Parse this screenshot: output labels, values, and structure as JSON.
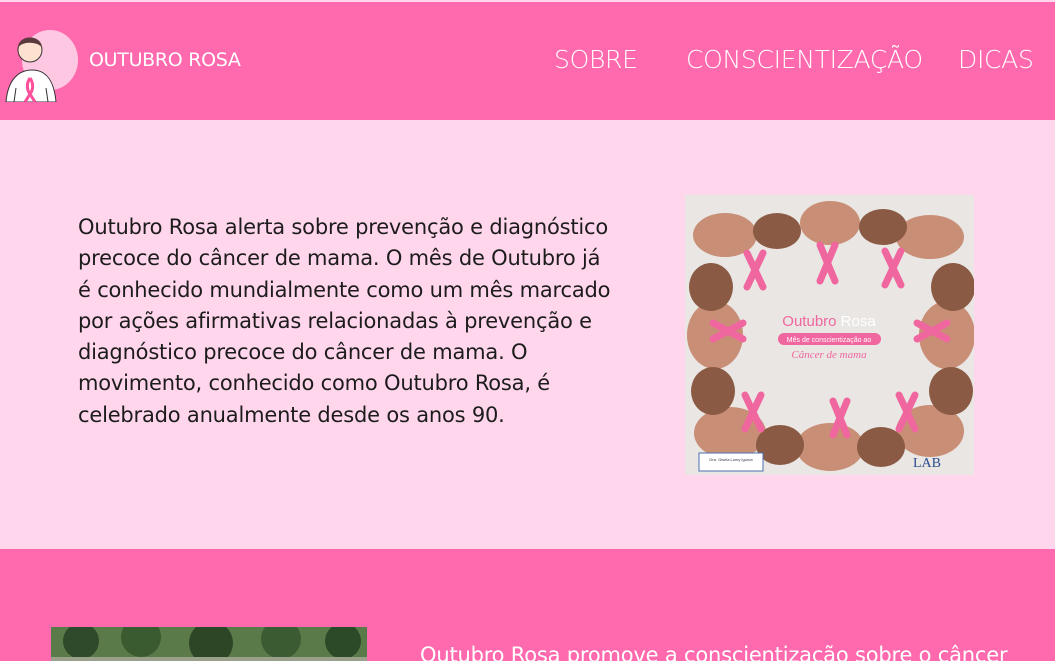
{
  "header": {
    "brand": "OUTUBRO ROSA",
    "nav": {
      "sobre": "SOBRE",
      "conscientizacao": "CONSCIENTIZAÇÃO",
      "dicas": "DICAS"
    },
    "logo_icon": "woman-with-pink-ribbon-icon"
  },
  "intro": {
    "text": "Outubro Rosa alerta sobre prevenção e diagnóstico precoce do câncer de mama. O mês de Outubro já é conhecido mundialmente como um mês marcado por ações afirmativas relacionadas à prevenção e diagnóstico precoce do câncer de mama. O movimento, conhecido como Outubro Rosa, é celebrado anualmente desde os anos 90."
  },
  "campaign_image": {
    "title_a": "Outubro",
    "title_b": "Rosa",
    "subtitle": "Mês de conscientização ao",
    "tagline": "Câncer de mama",
    "credit": "Dra. Gisela Lumy Iguma",
    "logo": "LAB"
  },
  "second_section": {
    "text": "Outubro Rosa promove a conscientização sobre o câncer"
  },
  "colors": {
    "header_bg": "#ff69ad",
    "section_light": "#ffd6ec",
    "accent_pink": "#f0679f"
  }
}
